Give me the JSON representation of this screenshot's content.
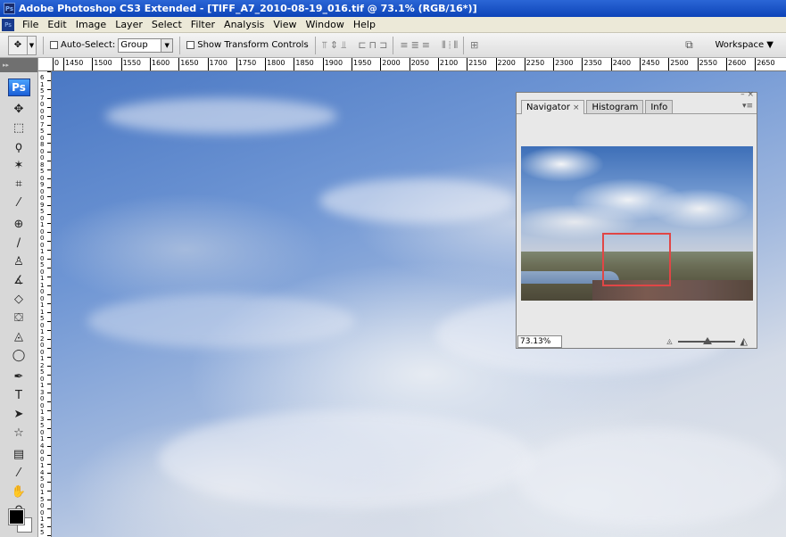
{
  "window": {
    "title": "Adobe Photoshop CS3 Extended - [TIFF_A7_2010-08-19_016.tif @ 73.1% (RGB/16*)]",
    "app_icon": "Ps"
  },
  "menu": {
    "items": [
      "File",
      "Edit",
      "Image",
      "Layer",
      "Select",
      "Filter",
      "Analysis",
      "View",
      "Window",
      "Help"
    ]
  },
  "options": {
    "auto_select_label": "Auto-Select:",
    "auto_select_value": "Group",
    "show_transform_label": "Show Transform Controls",
    "workspace_label": "Workspace ▼"
  },
  "toolbox": {
    "logo": "Ps",
    "tools": [
      {
        "name": "move-tool-icon",
        "glyph": "✥"
      },
      {
        "name": "marquee-tool-icon",
        "glyph": "⬚"
      },
      {
        "name": "lasso-tool-icon",
        "glyph": "ϙ"
      },
      {
        "name": "magic-wand-tool-icon",
        "glyph": "✶"
      },
      {
        "name": "crop-tool-icon",
        "glyph": "⌗"
      },
      {
        "name": "eyedropper-tool-icon",
        "glyph": "⁄"
      },
      {
        "name": "healing-brush-tool-icon",
        "glyph": "⊕"
      },
      {
        "name": "brush-tool-icon",
        "glyph": "∕"
      },
      {
        "name": "clone-stamp-tool-icon",
        "glyph": "♙"
      },
      {
        "name": "history-brush-tool-icon",
        "glyph": "∡"
      },
      {
        "name": "eraser-tool-icon",
        "glyph": "◇"
      },
      {
        "name": "paint-bucket-tool-icon",
        "glyph": "⛋"
      },
      {
        "name": "blur-tool-icon",
        "glyph": "◬"
      },
      {
        "name": "dodge-tool-icon",
        "glyph": "◯"
      },
      {
        "name": "pen-tool-icon",
        "glyph": "✒"
      },
      {
        "name": "type-tool-icon",
        "glyph": "T"
      },
      {
        "name": "path-selection-tool-icon",
        "glyph": "➤"
      },
      {
        "name": "custom-shape-tool-icon",
        "glyph": "☆"
      },
      {
        "name": "notes-tool-icon",
        "glyph": "▤"
      },
      {
        "name": "color-sampler-tool-icon",
        "glyph": "⁄"
      },
      {
        "name": "hand-tool-icon",
        "glyph": "✋"
      },
      {
        "name": "zoom-tool-icon",
        "glyph": "⚲"
      }
    ]
  },
  "ruler": {
    "h_labels": [
      "0",
      "1450",
      "1500",
      "1550",
      "1600",
      "1650",
      "1700",
      "1750",
      "1800",
      "1850",
      "1900",
      "1950",
      "2000",
      "2050",
      "2100",
      "2150",
      "2200",
      "2250",
      "2300",
      "2350",
      "2400",
      "2450",
      "2500",
      "2550",
      "2600",
      "2650"
    ],
    "v_labels": [
      "6",
      "1",
      "5",
      "7",
      "0",
      "0",
      "0",
      "7",
      "5",
      "0",
      "8",
      "0",
      "0",
      "8",
      "5",
      "0",
      "9",
      "0",
      "0",
      "9",
      "5",
      "0",
      "1",
      "0",
      "0",
      "0",
      "1",
      "0",
      "5",
      "0",
      "1",
      "1",
      "0",
      "0",
      "1",
      "1",
      "5",
      "0",
      "1",
      "2",
      "0",
      "0",
      "1",
      "2",
      "5",
      "0",
      "1",
      "3",
      "0",
      "0",
      "1",
      "3",
      "5",
      "0",
      "1",
      "4",
      "0",
      "0",
      "1",
      "4",
      "5",
      "0",
      "1",
      "5",
      "0",
      "0",
      "1",
      "5",
      "5"
    ]
  },
  "navigator": {
    "tabs": [
      {
        "label": "Navigator",
        "active": true,
        "has_close": true
      },
      {
        "label": "Histogram",
        "active": false
      },
      {
        "label": "Info",
        "active": false
      }
    ],
    "close_glyph": "×",
    "zoom_value": "73.13%",
    "view_box_color": "#e04646"
  }
}
